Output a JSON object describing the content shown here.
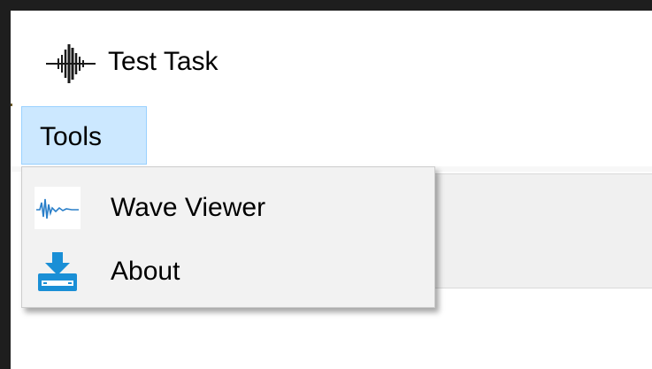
{
  "window": {
    "title": "Test Task",
    "app_icon": "waveform-icon"
  },
  "menubar": {
    "items": [
      {
        "label": "Tools",
        "state": "open"
      }
    ]
  },
  "dropdown": {
    "items": [
      {
        "label": "Wave Viewer",
        "icon": "wave-viewer-icon"
      },
      {
        "label": "About",
        "icon": "download-box-icon"
      }
    ]
  },
  "colors": {
    "menu_highlight": "#cce8ff",
    "menu_highlight_border": "#99d1ff",
    "dropdown_bg": "#f2f2f2",
    "icon_blue": "#1a8fd6"
  }
}
